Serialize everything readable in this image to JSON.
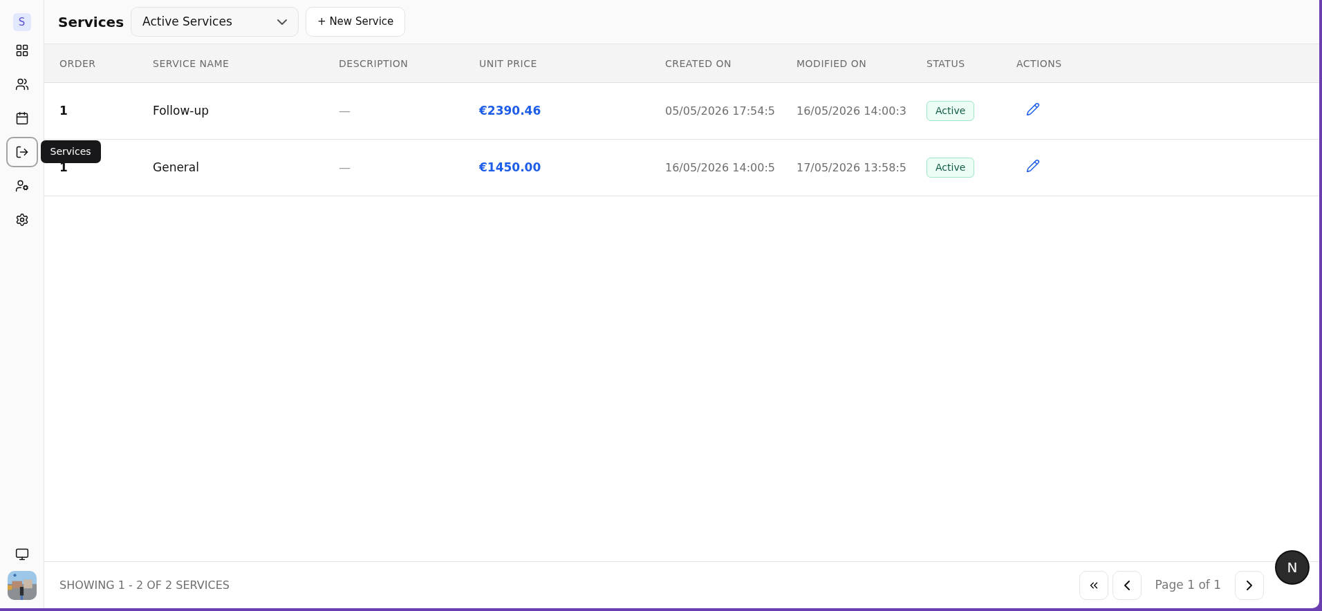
{
  "sidebar": {
    "logo": "S",
    "items": [
      {
        "kind": "grid",
        "selected": false
      },
      {
        "kind": "users",
        "selected": false
      },
      {
        "kind": "calendar",
        "selected": false
      },
      {
        "kind": "exit",
        "selected": true,
        "tooltip": "Services"
      },
      {
        "kind": "user-cog",
        "selected": false
      },
      {
        "kind": "settings",
        "selected": false
      }
    ],
    "bottom": [
      {
        "kind": "monitor"
      },
      {
        "kind": "picture"
      }
    ]
  },
  "header": {
    "title": "Services",
    "filter": {
      "value": "Active Services"
    },
    "new_button": "+ New Service"
  },
  "table": {
    "columns": [
      "ORDER",
      "SERVICE NAME",
      "DESCRIPTION",
      "UNIT PRICE",
      "CREATED ON",
      "MODIFIED ON",
      "STATUS",
      "ACTIONS"
    ],
    "rows": [
      {
        "order": "1",
        "name": "Follow-up",
        "description": "—",
        "price": "€2390.46",
        "created": "05/05/2026 17:54:5",
        "modified": "16/05/2026 14:00:3",
        "status": "Active"
      },
      {
        "order": "1",
        "name": "General",
        "description": "—",
        "price": "€1450.00",
        "created": "16/05/2026 14:00:5",
        "modified": "17/05/2026 13:58:5",
        "status": "Active"
      }
    ]
  },
  "footer": {
    "summary": "SHOWING 1 - 2 OF 2 SERVICES",
    "page": "Page 1 of 1"
  },
  "dev_badge": "N"
}
